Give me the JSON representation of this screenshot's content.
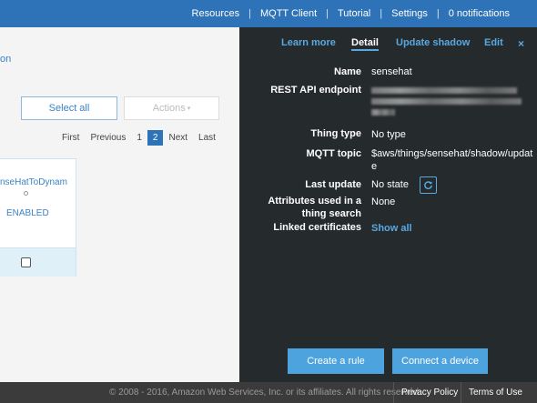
{
  "topnav": {
    "items": [
      "Resources",
      "MQTT Client",
      "Tutorial",
      "Settings"
    ],
    "notifications": "0 notifications"
  },
  "left": {
    "breadcrumb_fragment": "on",
    "select_all": "Select all",
    "actions": "Actions",
    "pagination": [
      "First",
      "Previous",
      "1",
      "2",
      "Next",
      "Last"
    ],
    "active_page": "2",
    "card": {
      "name": "nseHatToDynam",
      "status": "ENABLED"
    }
  },
  "panel": {
    "tabs": [
      "Learn more",
      "Detail",
      "Update shadow",
      "Edit"
    ],
    "active_tab": "Detail",
    "close": "×",
    "fields": {
      "name_label": "Name",
      "name_value": "sensehat",
      "endpoint_label": "REST API endpoint",
      "thing_type_label": "Thing type",
      "thing_type_value": "No type",
      "mqtt_label": "MQTT topic",
      "mqtt_value_1": "$aws/things/sensehat/shadow/updat",
      "mqtt_value_2": "e",
      "last_update_label": "Last update",
      "last_update_value": "No state",
      "attributes_label_1": "Attributes used in a",
      "attributes_label_2": "thing search",
      "attributes_value": "None",
      "certs_label": "Linked certificates",
      "certs_value": "Show all"
    },
    "create_rule": "Create a rule",
    "connect_device": "Connect a device"
  },
  "footer": {
    "copyright": "© 2008 - 2016, Amazon Web Services, Inc. or its affiliates. All rights reserved.",
    "privacy": "Privacy Policy",
    "terms": "Terms of Use"
  },
  "icons": {
    "refresh": "refresh-icon",
    "close": "close-icon",
    "caret": "caret-down-icon"
  },
  "colors": {
    "brand": "#2e73b8",
    "panel_bg": "#252a2d",
    "accent": "#4ca3dd"
  }
}
